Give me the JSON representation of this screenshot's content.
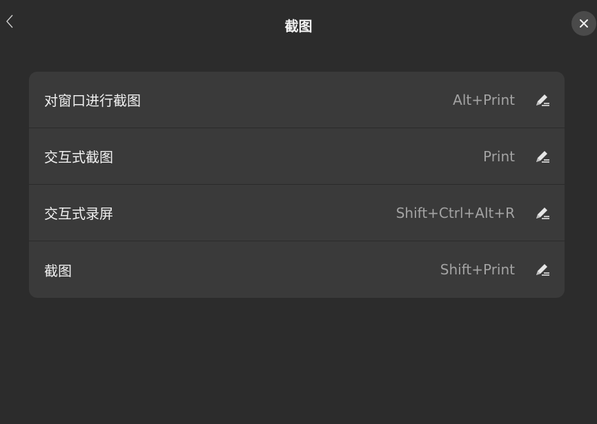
{
  "header": {
    "back_icon": "chevron-left-icon",
    "title": "截图",
    "close_icon": "close-icon"
  },
  "shortcuts": [
    {
      "label": "对窗口进行截图",
      "shortcut": "Alt+Print",
      "icon": "edit-icon"
    },
    {
      "label": "交互式截图",
      "shortcut": "Print",
      "icon": "edit-icon"
    },
    {
      "label": "交互式录屏",
      "shortcut": "Shift+Ctrl+Alt+R",
      "icon": "edit-icon"
    },
    {
      "label": "截图",
      "shortcut": "Shift+Print",
      "icon": "edit-icon"
    }
  ],
  "colors": {
    "background": "#2c2c2c",
    "card": "#3a3a3a",
    "text": "#f0f0f0",
    "shortcut_text": "#a3a3a3"
  }
}
